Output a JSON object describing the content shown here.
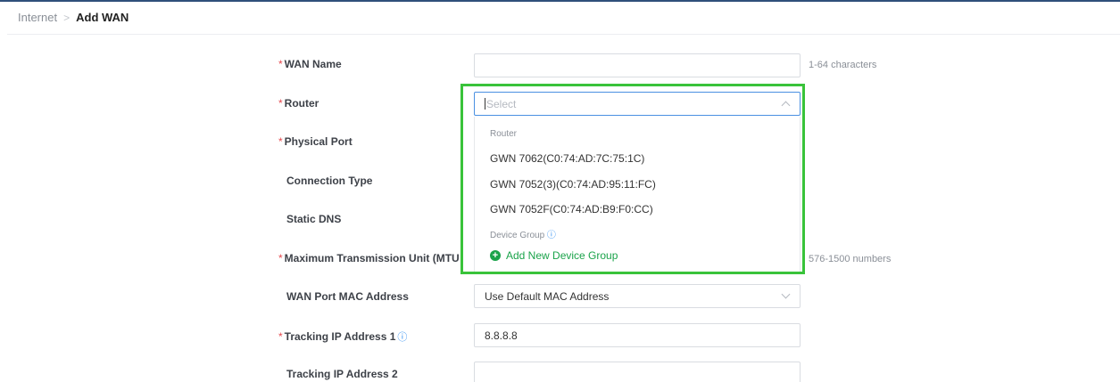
{
  "breadcrumb": {
    "parent": "Internet",
    "separator": ">",
    "current": "Add WAN"
  },
  "form": {
    "wan_name": {
      "label": "WAN Name",
      "required": true,
      "value": "",
      "hint": "1-64 characters"
    },
    "router": {
      "label": "Router",
      "required": true,
      "placeholder": "Select",
      "open": true
    },
    "physical_port": {
      "label": "Physical Port",
      "required": true
    },
    "connection_type": {
      "label": "Connection Type",
      "required": false
    },
    "static_dns": {
      "label": "Static DNS",
      "required": false
    },
    "mtu": {
      "label": "Maximum Transmission Unit (MTU",
      "required": true,
      "hint": "576-1500 numbers"
    },
    "wan_mac": {
      "label": "WAN Port MAC Address",
      "required": false,
      "value": "Use Default MAC Address"
    },
    "tracking_ip_1": {
      "label": "Tracking IP Address 1",
      "required": true,
      "value": "8.8.8.8",
      "info_icon": "info-circle-icon"
    },
    "tracking_ip_2": {
      "label": "Tracking IP Address 2",
      "required": false,
      "value": ""
    }
  },
  "router_dropdown": {
    "group_router": "Router",
    "options": [
      "GWN 7062(C0:74:AD:7C:75:1C)",
      "GWN 7052(3)(C0:74:AD:95:11:FC)",
      "GWN 7052F(C0:74:AD:B9:F0:CC)"
    ],
    "group_device": "Device Group",
    "add_group_label": "Add New Device Group"
  },
  "colors": {
    "required": "#e5484d",
    "accent_blue": "#4a90e2",
    "add_green": "#1aa34a",
    "highlight": "#39c33a"
  }
}
